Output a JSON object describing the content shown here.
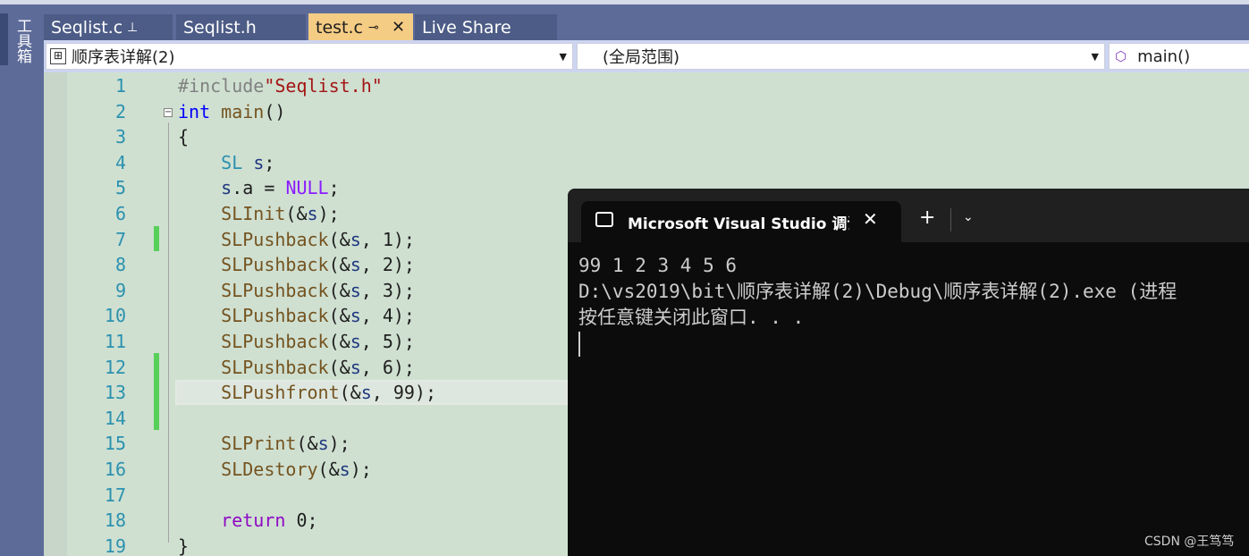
{
  "toolbox": {
    "label": "工具箱"
  },
  "tabs": [
    {
      "label": "Seqlist.c",
      "pin": "⊥",
      "active": false
    },
    {
      "label": "Seqlist.h",
      "active": false
    },
    {
      "label": "test.c",
      "pin": "⊸",
      "close": "✕",
      "active": true
    },
    {
      "label": "Live Share",
      "active": false
    }
  ],
  "navbar": {
    "project": "顺序表详解(2)",
    "scope": "(全局范围)",
    "member": "main()"
  },
  "editor": {
    "lines": [
      {
        "n": "1",
        "tokens": [
          [
            "pre",
            "#include"
          ],
          [
            "str",
            "\"Seqlist.h\""
          ]
        ]
      },
      {
        "n": "2",
        "tokens": [
          [
            "kw",
            "int"
          ],
          [
            "plain",
            " "
          ],
          [
            "fn",
            "main"
          ],
          [
            "plain",
            "()"
          ]
        ]
      },
      {
        "n": "3",
        "tokens": [
          [
            "plain",
            "{"
          ]
        ]
      },
      {
        "n": "4",
        "tokens": [
          [
            "plain",
            "    "
          ],
          [
            "type",
            "SL"
          ],
          [
            "plain",
            " "
          ],
          [
            "var",
            "s"
          ],
          [
            "plain",
            ";"
          ]
        ]
      },
      {
        "n": "5",
        "tokens": [
          [
            "plain",
            "    "
          ],
          [
            "var",
            "s"
          ],
          [
            "plain",
            ".a = "
          ],
          [
            "macro",
            "NULL"
          ],
          [
            "plain",
            ";"
          ]
        ]
      },
      {
        "n": "6",
        "tokens": [
          [
            "plain",
            "    "
          ],
          [
            "fn",
            "SLInit"
          ],
          [
            "plain",
            "(&"
          ],
          [
            "var",
            "s"
          ],
          [
            "plain",
            ");"
          ]
        ]
      },
      {
        "n": "7",
        "tokens": [
          [
            "plain",
            "    "
          ],
          [
            "fn",
            "SLPushback"
          ],
          [
            "plain",
            "(&"
          ],
          [
            "var",
            "s"
          ],
          [
            "plain",
            ", 1);"
          ]
        ]
      },
      {
        "n": "8",
        "tokens": [
          [
            "plain",
            "    "
          ],
          [
            "fn",
            "SLPushback"
          ],
          [
            "plain",
            "(&"
          ],
          [
            "var",
            "s"
          ],
          [
            "plain",
            ", 2);"
          ]
        ]
      },
      {
        "n": "9",
        "tokens": [
          [
            "plain",
            "    "
          ],
          [
            "fn",
            "SLPushback"
          ],
          [
            "plain",
            "(&"
          ],
          [
            "var",
            "s"
          ],
          [
            "plain",
            ", 3);"
          ]
        ]
      },
      {
        "n": "10",
        "tokens": [
          [
            "plain",
            "    "
          ],
          [
            "fn",
            "SLPushback"
          ],
          [
            "plain",
            "(&"
          ],
          [
            "var",
            "s"
          ],
          [
            "plain",
            ", 4);"
          ]
        ]
      },
      {
        "n": "11",
        "tokens": [
          [
            "plain",
            "    "
          ],
          [
            "fn",
            "SLPushback"
          ],
          [
            "plain",
            "(&"
          ],
          [
            "var",
            "s"
          ],
          [
            "plain",
            ", 5);"
          ]
        ]
      },
      {
        "n": "12",
        "tokens": [
          [
            "plain",
            "    "
          ],
          [
            "fn",
            "SLPushback"
          ],
          [
            "plain",
            "(&"
          ],
          [
            "var",
            "s"
          ],
          [
            "plain",
            ", 6);"
          ]
        ]
      },
      {
        "n": "13",
        "tokens": [
          [
            "plain",
            "    "
          ],
          [
            "fn",
            "SLPushfront"
          ],
          [
            "plain",
            "(&"
          ],
          [
            "var",
            "s"
          ],
          [
            "plain",
            ", 99);"
          ]
        ]
      },
      {
        "n": "14",
        "tokens": []
      },
      {
        "n": "15",
        "tokens": [
          [
            "plain",
            "    "
          ],
          [
            "fn",
            "SLPrint"
          ],
          [
            "plain",
            "(&"
          ],
          [
            "var",
            "s"
          ],
          [
            "plain",
            ");"
          ]
        ]
      },
      {
        "n": "16",
        "tokens": [
          [
            "plain",
            "    "
          ],
          [
            "fn",
            "SLDestory"
          ],
          [
            "plain",
            "(&"
          ],
          [
            "var",
            "s"
          ],
          [
            "plain",
            ");"
          ]
        ]
      },
      {
        "n": "17",
        "tokens": []
      },
      {
        "n": "18",
        "tokens": [
          [
            "plain",
            "    "
          ],
          [
            "ret",
            "return"
          ],
          [
            "plain",
            " 0;"
          ]
        ]
      },
      {
        "n": "19",
        "tokens": [
          [
            "plain",
            "}"
          ]
        ]
      }
    ]
  },
  "console": {
    "title": "Microsoft Visual Studio 调试控制台",
    "close": "✕",
    "new_tab": "+",
    "dropdown": "⌄",
    "output": [
      "99 1 2 3 4 5 6",
      "D:\\vs2019\\bit\\顺序表详解(2)\\Debug\\顺序表详解(2).exe (进程",
      "按任意键关闭此窗口. . ."
    ]
  },
  "watermark": "CSDN @王笃笃",
  "colors": {
    "editor_bg": "#CFE0D1",
    "chrome": "#5D6B99",
    "active_tab": "#F5CC84",
    "line_number": "#2B91AF",
    "change_bar": "#57D05A",
    "console_bg": "#0C0C0C"
  }
}
